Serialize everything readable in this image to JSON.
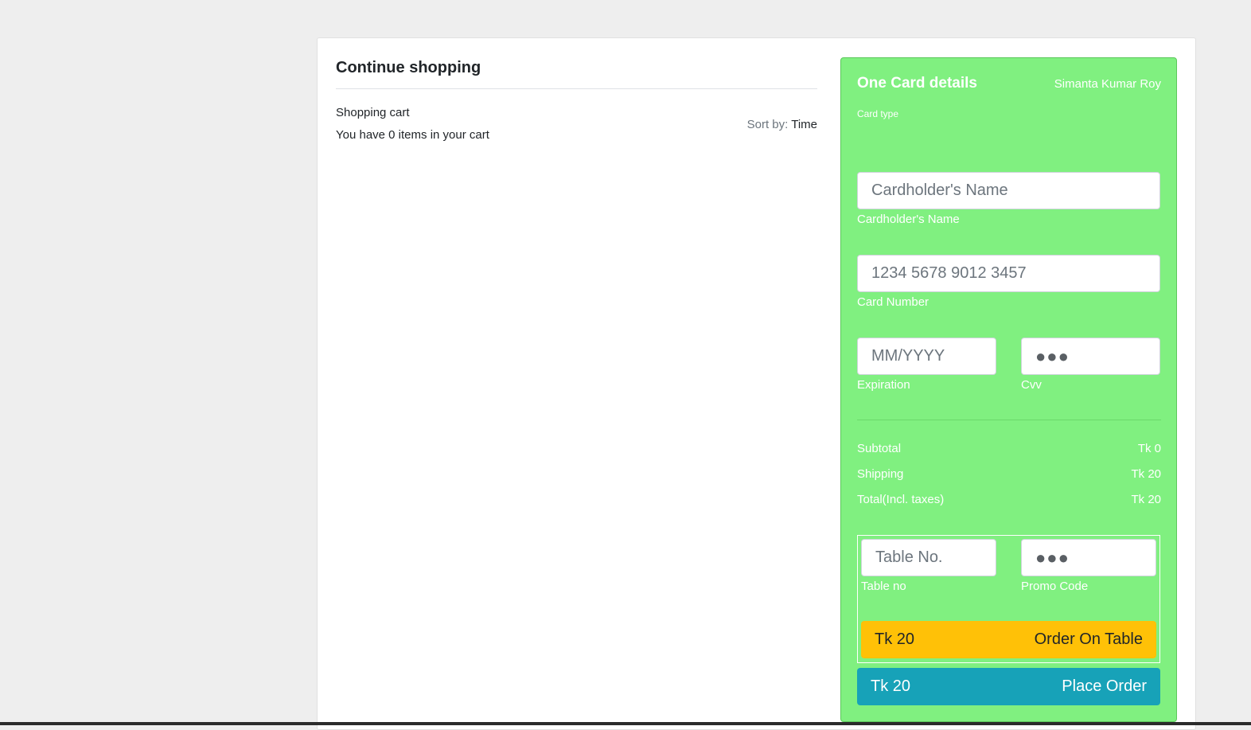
{
  "left": {
    "heading": "Continue shopping",
    "cart_title": "Shopping cart",
    "cart_count_text": "You have 0 items in your cart",
    "sort_label": "Sort by:",
    "sort_value": "Time"
  },
  "card": {
    "title": "One Card details",
    "owner": "Simanta Kumar Roy",
    "card_type_label": "Card type",
    "cardholder_placeholder": "Cardholder's Name",
    "cardholder_label": "Cardholder's Name",
    "card_number_value": "1234 5678 9012 3457",
    "card_number_label": "Card Number",
    "expiration_placeholder": "MM/YYYY",
    "expiration_label": "Expiration",
    "cvv_value": "●●●",
    "cvv_label": "Cvv"
  },
  "summary": {
    "subtotal_label": "Subtotal",
    "subtotal_value": "Tk 0",
    "shipping_label": "Shipping",
    "shipping_value": "Tk 20",
    "total_label": "Total(Incl. taxes)",
    "total_value": "Tk 20"
  },
  "table_order": {
    "table_placeholder": "Table No.",
    "table_label": "Table no",
    "promo_value": "●●●",
    "promo_label": "Promo Code",
    "order_amount": "Tk 20",
    "order_label": "Order On Table"
  },
  "place_order": {
    "amount": "Tk 20",
    "label": "Place Order"
  },
  "colors": {
    "panel_bg": "#80f080",
    "order_button": "#ffc107",
    "place_button": "#17a2b8",
    "page_bg": "#eeeeee"
  }
}
